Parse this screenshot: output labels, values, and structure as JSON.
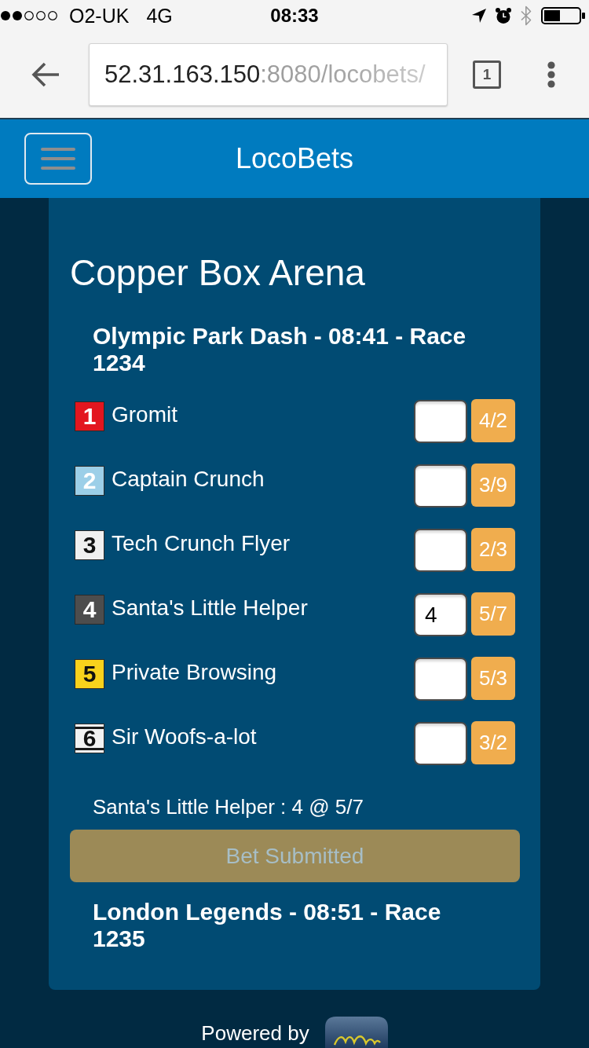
{
  "status_bar": {
    "carrier": "O2-UK",
    "network": "4G",
    "time": "08:33"
  },
  "browser": {
    "url_host": "52.31.163.150",
    "url_path": ":8080/locobets/",
    "tab_count": "1"
  },
  "navbar": {
    "brand": "LocoBets"
  },
  "venue": {
    "title": "Copper Box Arena",
    "races": [
      {
        "title": "Olympic Park Dash - 08:41 - Race 1234",
        "runners": [
          {
            "badge": {
              "number": "1",
              "kind": "solid",
              "color": "#e3161f"
            },
            "name": "Gromit",
            "odds": "4/2"
          },
          {
            "badge": {
              "number": "2",
              "kind": "solid",
              "color": "#9ccfe8"
            },
            "name": "Captain Crunch",
            "odds": "3/9"
          },
          {
            "badge": {
              "number": "3",
              "kind": "solid",
              "color": "#f0f0f0"
            },
            "name": "Tech Crunch Flyer",
            "odds": "2/3"
          },
          {
            "badge": {
              "number": "4",
              "kind": "solid",
              "color": "#4d4d4d"
            },
            "name": "Santa's Little Helper",
            "stake": "4",
            "odds": "5/7"
          },
          {
            "badge": {
              "number": "5",
              "kind": "solid",
              "color": "#f8d21c"
            },
            "name": "Private Browsing",
            "odds": "5/3"
          },
          {
            "badge": {
              "number": "6",
              "kind": "striped",
              "color": "#f2f2f2"
            },
            "name": "Sir Woofs-a-lot",
            "odds": "3/2"
          }
        ],
        "bet": {
          "summary": "Santa's Little Helper : 4 @ 5/7",
          "button": {
            "label": "Bet Submitted",
            "disabled": true
          }
        }
      },
      {
        "title": "London Legends - 08:51 - Race 1235"
      }
    ]
  },
  "footer": {
    "text": "Powered by"
  }
}
